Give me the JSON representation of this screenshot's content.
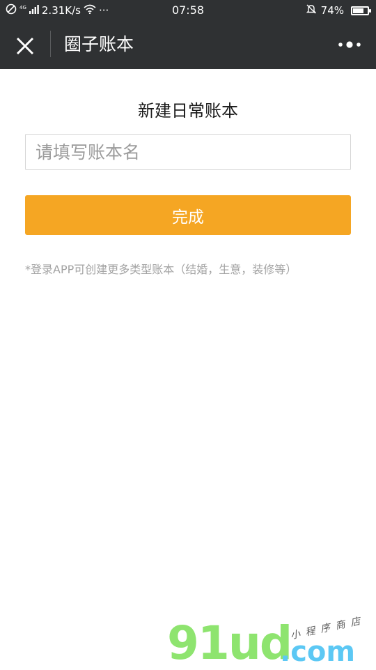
{
  "status_bar": {
    "network_type": "4G",
    "speed": "2.31K/s",
    "more": "···",
    "time": "07:58",
    "battery": "74%",
    "battery_level": 0.74
  },
  "navbar": {
    "title": "圈子账本"
  },
  "form": {
    "heading": "新建日常账本",
    "name_placeholder": "请填写账本名",
    "name_value": "",
    "submit_label": "完成",
    "hint": "*登录APP可创建更多类型账本（结婚，生意，装修等）"
  },
  "watermark": {
    "logo": "91ud",
    "domain": ".com",
    "slogan": "小程序商店"
  },
  "colors": {
    "bar_bg": "#2f3133",
    "accent": "#f5a623",
    "hint_text": "#a3a3a3"
  }
}
